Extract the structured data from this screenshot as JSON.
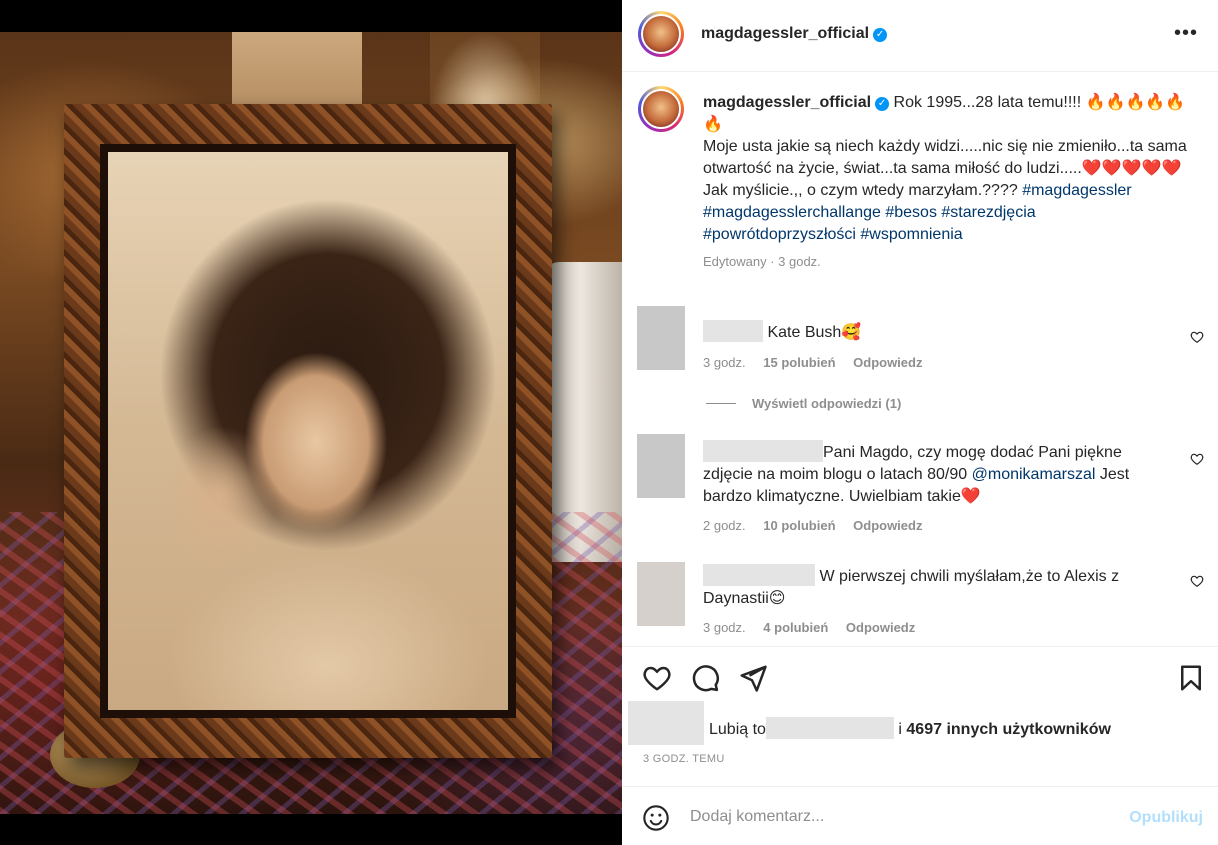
{
  "post": {
    "username": "magdagessler_official",
    "more_icon": "more-dots-icon",
    "verified_icon": "verified-badge-icon"
  },
  "caption": {
    "username": "magdagessler_official",
    "line1": "Rok 1995...28 lata temu!!!! 🔥🔥🔥🔥🔥🔥",
    "line2": "Moje usta jakie są niech każdy widzi.....nic się nie zmieniło...ta sama otwartość na życie, świat...ta sama miłość do ludzi.....❤️❤️❤️❤️❤️",
    "line3": "Jak myślicie.,, o czym wtedy marzyłam.????",
    "hashtags": "#magdagessler #magdagesslerchallange #besos #starezdjęcia #powrótdoprzyszłości #wspomnienia",
    "meta": "Edytowany · 3 godz."
  },
  "comments": [
    {
      "text": "Kate Bush🥰",
      "time": "3 godz.",
      "likes": "15 polubień",
      "reply": "Odpowiedz"
    },
    {
      "text": "Pani Magdo, czy mogę dodać Pani piękne zdjęcie na moim blogu o latach 80/90",
      "mention": "@monikamarszal",
      "text_after": "Jest bardzo klimatyczne. Uwielbiam takie❤️",
      "time": "2 godz.",
      "likes": "10 polubień",
      "reply": "Odpowiedz"
    },
    {
      "text": "W pierwszej chwili myślałam,że to Alexis z Daynastii😊",
      "time": "3 godz.",
      "likes": "4 polubień",
      "reply": "Odpowiedz"
    }
  ],
  "view_replies": "Wyświetl odpowiedzi (1)",
  "likes": {
    "prefix": "Lubią to",
    "connector": "i",
    "count": "4697 innych użytkowników"
  },
  "timestamp": "3 GODZ. TEMU",
  "comment_box": {
    "placeholder": "Dodaj komentarz...",
    "publish": "Opublikuj"
  },
  "colors": {
    "link": "#00376b",
    "publish_disabled": "#b2dffc",
    "verified": "#0095f6"
  }
}
